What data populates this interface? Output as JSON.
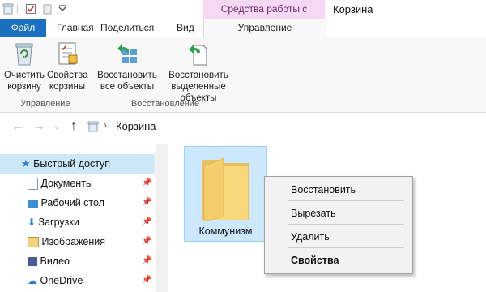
{
  "titlebar": {
    "context_tab_label": "Средства работы с корзиной",
    "window_title": "Корзина"
  },
  "tabs": {
    "file": "Файл",
    "home": "Главная",
    "share": "Поделиться",
    "view": "Вид",
    "manage": "Управление"
  },
  "ribbon": {
    "groups": [
      {
        "label": "Управление",
        "buttons": [
          {
            "label_line1": "Очистить",
            "label_line2": "корзину",
            "icon": "empty-bin-icon"
          },
          {
            "label_line1": "Свойства",
            "label_line2": "корзины",
            "icon": "properties-icon"
          }
        ]
      },
      {
        "label": "Восстановление",
        "buttons": [
          {
            "label_line1": "Восстановить",
            "label_line2": "все объекты",
            "icon": "restore-all-icon"
          },
          {
            "label_line1": "Восстановить",
            "label_line2": "выделенные объекты",
            "icon": "restore-selected-icon"
          }
        ]
      }
    ]
  },
  "address": {
    "path": "Корзина"
  },
  "nav": {
    "items": [
      {
        "label": "Быстрый доступ",
        "icon": "star-icon",
        "pinned": false
      },
      {
        "label": "Документы",
        "icon": "documents-icon",
        "pinned": true
      },
      {
        "label": "Рабочий стол",
        "icon": "desktop-folder-icon",
        "pinned": true
      },
      {
        "label": "Загрузки",
        "icon": "downloads-icon",
        "pinned": true
      },
      {
        "label": "Изображения",
        "icon": "pictures-icon",
        "pinned": true
      },
      {
        "label": "Видео",
        "icon": "videos-icon",
        "pinned": true
      },
      {
        "label": "OneDrive",
        "icon": "onedrive-icon",
        "pinned": true
      }
    ]
  },
  "content": {
    "folder_name": "Коммунизм"
  },
  "context_menu": {
    "items": [
      "Восстановить",
      "Вырезать",
      "Удалить",
      "Свойства"
    ]
  },
  "colors": {
    "file_tab": "#1a6fbf",
    "context_tab_bg": "#f4d8f4",
    "selection": "#cce8ff"
  }
}
